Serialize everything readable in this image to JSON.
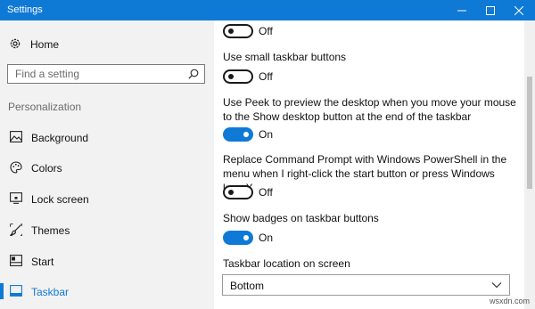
{
  "window": {
    "title": "Settings",
    "accent_color": "#0f7ad6"
  },
  "sidebar": {
    "home_label": "Home",
    "search_placeholder": "Find a setting",
    "section_title": "Personalization",
    "items": [
      {
        "label": "Background",
        "icon": "picture-icon"
      },
      {
        "label": "Colors",
        "icon": "palette-icon"
      },
      {
        "label": "Lock screen",
        "icon": "lock-screen-icon"
      },
      {
        "label": "Themes",
        "icon": "brush-icon"
      },
      {
        "label": "Start",
        "icon": "start-menu-icon"
      },
      {
        "label": "Taskbar",
        "icon": "taskbar-icon",
        "selected": true
      }
    ]
  },
  "main": {
    "toggle0": {
      "state": "Off",
      "on": false
    },
    "small_buttons": {
      "label": "Use small taskbar buttons",
      "state": "Off",
      "on": false
    },
    "peek": {
      "label": "Use Peek to preview the desktop when you move your mouse to the Show desktop button at the end of the taskbar",
      "state": "On",
      "on": true
    },
    "powershell": {
      "label": "Replace Command Prompt with Windows PowerShell in the menu when I right-click the start button or press Windows key+X",
      "state": "Off",
      "on": false
    },
    "badges": {
      "label": "Show badges on taskbar buttons",
      "state": "On",
      "on": true
    },
    "location": {
      "label": "Taskbar location on screen",
      "value": "Bottom"
    }
  },
  "watermark": "wsxdn.com"
}
